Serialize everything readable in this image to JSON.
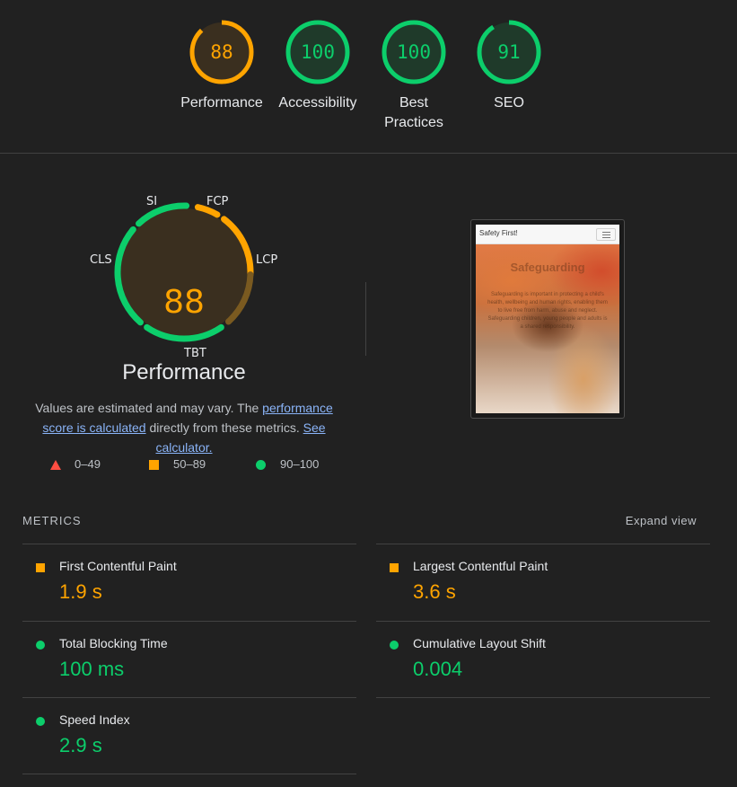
{
  "categories": [
    {
      "label": "Performance",
      "score": "88",
      "value": 88,
      "status": "average"
    },
    {
      "label": "Accessibility",
      "score": "100",
      "value": 100,
      "status": "pass"
    },
    {
      "label": "Best Practices",
      "score": "100",
      "value": 100,
      "status": "pass"
    },
    {
      "label": "SEO",
      "score": "91",
      "value": 91,
      "status": "pass"
    }
  ],
  "colors": {
    "pass": "#0cce6b",
    "average": "#ffa400",
    "fail": "#ff4e42",
    "pass_bg": "#1f3a2a",
    "average_bg": "#3a2f1f",
    "link": "#8ab4f8"
  },
  "performance": {
    "score": "88",
    "title": "Performance",
    "metric_tags": {
      "si": "SI",
      "fcp": "FCP",
      "lcp": "LCP",
      "tbt": "TBT",
      "cls": "CLS"
    },
    "description_prefix": "Values are estimated and may vary. The ",
    "score_link": "performance score is calculated",
    "description_middle": " directly from these metrics. ",
    "calculator_link": "See calculator."
  },
  "legend": [
    {
      "range": "0–49",
      "shape": "triangle-icon"
    },
    {
      "range": "50–89",
      "shape": "square-icon"
    },
    {
      "range": "90–100",
      "shape": "circle-icon"
    }
  ],
  "screenshot": {
    "brand": "Safety First!",
    "hero_title": "Safeguarding",
    "hero_text": "Safeguarding is important in protecting a child's health, wellbeing and human rights, enabling them to live free from harm, abuse and neglect. Safeguarding children, young people and adults is a shared responsibility."
  },
  "metrics": {
    "title": "METRICS",
    "expand_label": "Expand view",
    "items": [
      {
        "name": "First Contentful Paint",
        "value": "1.9 s",
        "status": "average"
      },
      {
        "name": "Largest Contentful Paint",
        "value": "3.6 s",
        "status": "average"
      },
      {
        "name": "Total Blocking Time",
        "value": "100 ms",
        "status": "pass"
      },
      {
        "name": "Cumulative Layout Shift",
        "value": "0.004",
        "status": "pass"
      },
      {
        "name": "Speed Index",
        "value": "2.9 s",
        "status": "pass"
      }
    ]
  }
}
